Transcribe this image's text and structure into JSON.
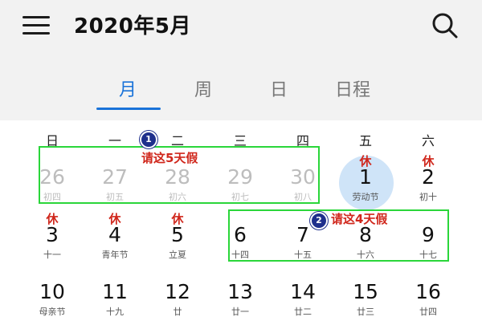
{
  "header": {
    "title": "2020年5月"
  },
  "tabs": [
    {
      "label": "月",
      "active": true
    },
    {
      "label": "周",
      "active": false
    },
    {
      "label": "日",
      "active": false
    },
    {
      "label": "日程",
      "active": false
    }
  ],
  "weekdays": [
    "日",
    "一",
    "二",
    "三",
    "四",
    "五",
    "六"
  ],
  "weeks": [
    [
      {
        "num": "26",
        "lunar": "初四",
        "holiday": "",
        "other": true
      },
      {
        "num": "27",
        "lunar": "初五",
        "holiday": "",
        "other": true
      },
      {
        "num": "28",
        "lunar": "初六",
        "holiday": "",
        "other": true
      },
      {
        "num": "29",
        "lunar": "初七",
        "holiday": "",
        "other": true
      },
      {
        "num": "30",
        "lunar": "初八",
        "holiday": "",
        "other": true
      },
      {
        "num": "1",
        "lunar": "劳动节",
        "holiday": "休",
        "other": false,
        "today": true
      },
      {
        "num": "2",
        "lunar": "初十",
        "holiday": "休",
        "other": false
      }
    ],
    [
      {
        "num": "3",
        "lunar": "十一",
        "holiday": "休",
        "other": false
      },
      {
        "num": "4",
        "lunar": "青年节",
        "holiday": "休",
        "other": false
      },
      {
        "num": "5",
        "lunar": "立夏",
        "holiday": "休",
        "other": false
      },
      {
        "num": "6",
        "lunar": "十四",
        "holiday": "",
        "other": false
      },
      {
        "num": "7",
        "lunar": "十五",
        "holiday": "",
        "other": false
      },
      {
        "num": "8",
        "lunar": "十六",
        "holiday": "",
        "other": false
      },
      {
        "num": "9",
        "lunar": "十七",
        "holiday": "",
        "other": false
      }
    ],
    [
      {
        "num": "10",
        "lunar": "母亲节",
        "holiday": "",
        "other": false
      },
      {
        "num": "11",
        "lunar": "十九",
        "holiday": "",
        "other": false
      },
      {
        "num": "12",
        "lunar": "廿",
        "holiday": "",
        "other": false
      },
      {
        "num": "13",
        "lunar": "廿一",
        "holiday": "",
        "other": false
      },
      {
        "num": "14",
        "lunar": "廿二",
        "holiday": "",
        "other": false
      },
      {
        "num": "15",
        "lunar": "廿三",
        "holiday": "",
        "other": false
      },
      {
        "num": "16",
        "lunar": "廿四",
        "holiday": "",
        "other": false
      }
    ]
  ],
  "annotations": [
    {
      "badge": "1",
      "text": "请这5天假"
    },
    {
      "badge": "2",
      "text": "请这4天假"
    }
  ],
  "colors": {
    "accent": "#1a73d9",
    "holiday": "#d0271c",
    "highlight_box": "#2ad63a",
    "today_bg": "#cfe4f8"
  }
}
